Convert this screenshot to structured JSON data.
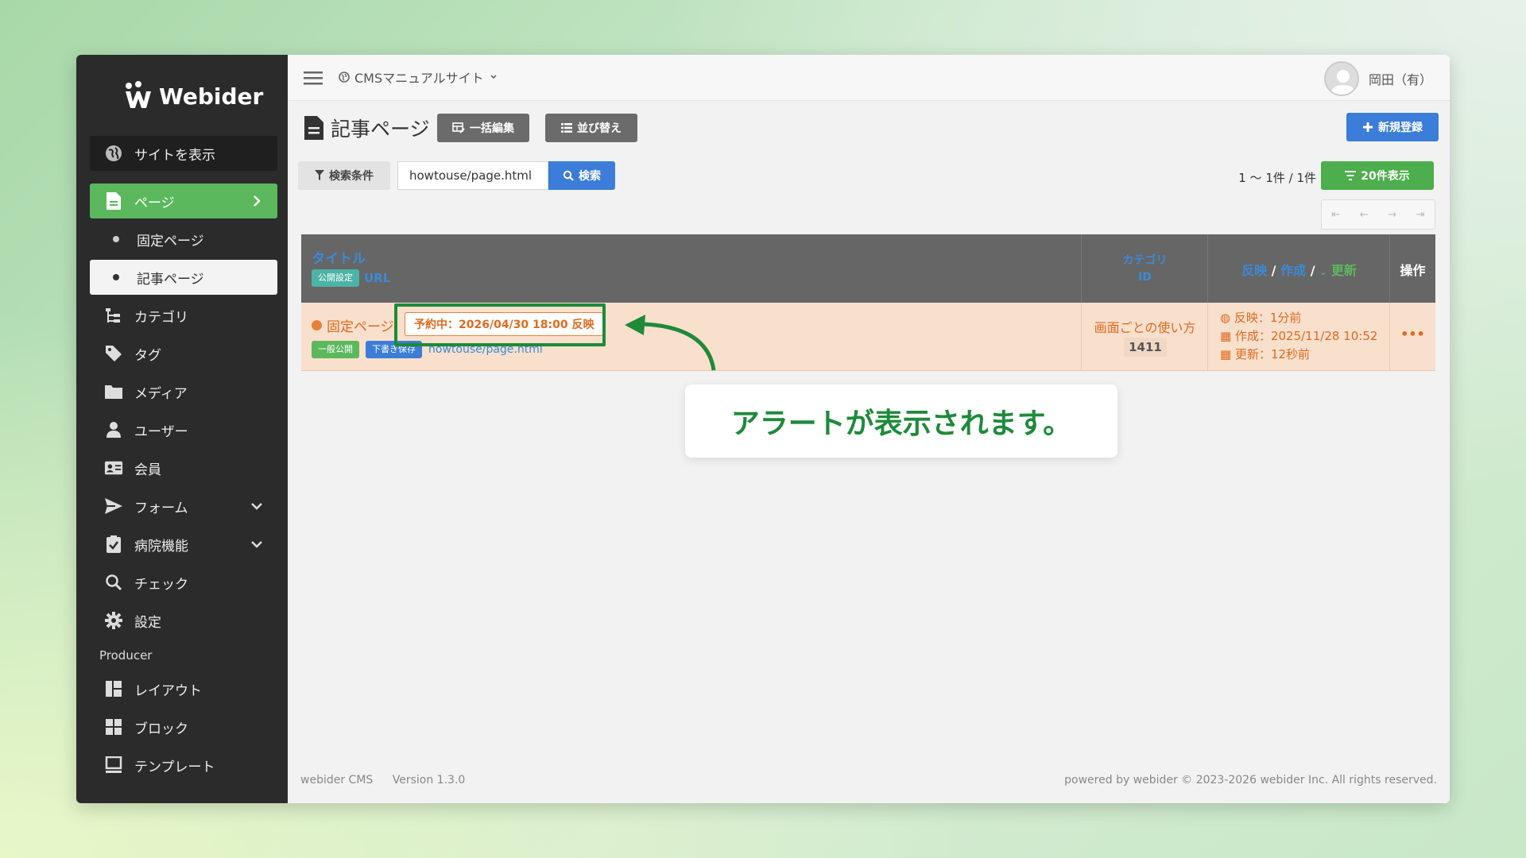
{
  "sidebar": {
    "logo_text": "Webider",
    "site_link": "サイトを表示",
    "items": [
      {
        "label": "ページ"
      },
      {
        "label": "固定ページ"
      },
      {
        "label": "記事ページ"
      },
      {
        "label": "カテゴリ"
      },
      {
        "label": "タグ"
      },
      {
        "label": "メディア"
      },
      {
        "label": "ユーザー"
      },
      {
        "label": "会員"
      },
      {
        "label": "フォーム"
      },
      {
        "label": "病院機能"
      },
      {
        "label": "チェック"
      },
      {
        "label": "設定"
      }
    ],
    "producer_label": "Producer",
    "producer_items": [
      {
        "label": "レイアウト"
      },
      {
        "label": "ブロック"
      },
      {
        "label": "テンプレート"
      }
    ]
  },
  "topbar": {
    "site_name": "CMSマニュアルサイト",
    "user_name": "岡田（有）"
  },
  "page": {
    "title": "記事ページ",
    "bulk_edit": "一括編集",
    "sort": "並び替え",
    "new": "新規登録",
    "filter": "検索条件",
    "search_value": "howtouse/page.html",
    "search_button": "検索",
    "range": "1 〜 1件 / 1件",
    "per_page": "20件表示",
    "pager": [
      "⇤",
      "←",
      "→",
      "⇥"
    ]
  },
  "table": {
    "headers": {
      "title": "タイトル",
      "publish": "公開設定",
      "url": "URL",
      "category": "カテゴリ",
      "id": "ID",
      "reflect": "反映",
      "created": "作成",
      "updated": "更新",
      "action": "操作"
    },
    "rows": [
      {
        "title": "固定ページ",
        "alert": "予約中：2026/04/30 18:00 反映",
        "badge_public": "一般公開",
        "badge_draft": "下書き保存",
        "url": "howtouse/page.html",
        "category": "画面ごとの使い方",
        "id": "1411",
        "reflect": "反映：1分前",
        "created": "作成：2025/11/28 10:52",
        "updated": "更新：12秒前",
        "menu": "•••"
      }
    ]
  },
  "callout": "アラートが表示されます。",
  "footer": {
    "product": "webider CMS",
    "version": "Version 1.3.0",
    "copyright": "powered by webider © 2023-2026 webider Inc. All rights reserved."
  },
  "colors": {
    "sidebar_bg": "#2b2b2b",
    "active_green": "#5cb85c",
    "primary_blue": "#3b7dd8",
    "highlight_green": "#1e8a3a",
    "row_bg": "#f9e0cd",
    "alert_orange": "#e06a1f"
  }
}
